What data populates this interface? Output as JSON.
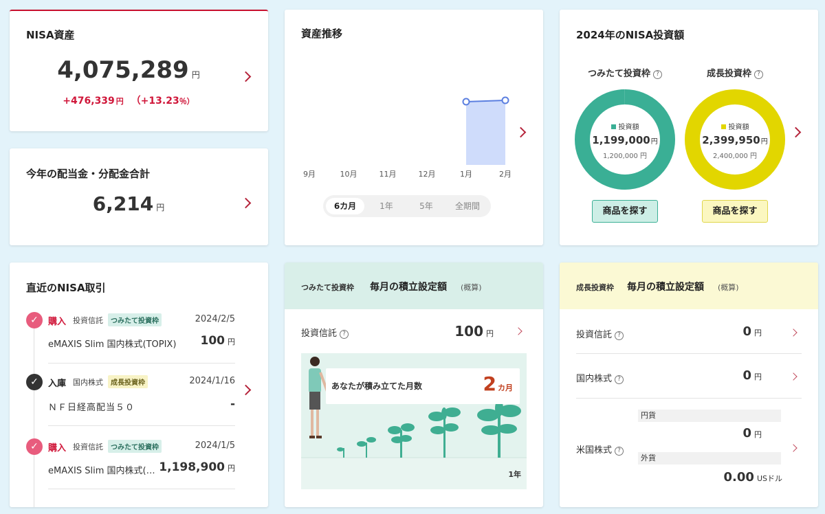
{
  "nisa_assets": {
    "title": "NISA資産",
    "amount": "4,075,289",
    "unit": "円",
    "gain": "+476,339",
    "gain_unit": "円",
    "gain_pct": "（+13.23",
    "pct_unit": "％）"
  },
  "dividends": {
    "title": "今年の配当金・分配金合計",
    "amount": "6,214",
    "unit": "円"
  },
  "asset_trend": {
    "title": "資産推移",
    "periods": [
      "6カ月",
      "1年",
      "5年",
      "全期間"
    ],
    "selected_period": "6カ月",
    "chart_data": {
      "type": "area",
      "x": [
        "9月",
        "10月",
        "11月",
        "12月",
        "1月",
        "2月"
      ],
      "series": [
        {
          "values": [
            null,
            null,
            null,
            null,
            3980000,
            4075289
          ]
        }
      ]
    }
  },
  "investment_2024": {
    "title": "2024年のNISA投資額",
    "tsumitate": {
      "label": "つみたて投資枠",
      "legend": "投資額",
      "amount": "1,199,000",
      "unit": "円",
      "limit": "1,200,000 円",
      "button": "商品を探す",
      "color": "#3aaf95",
      "fraction": 0.9992
    },
    "seicho": {
      "label": "成長投資枠",
      "legend": "投資額",
      "amount": "2,399,950",
      "unit": "円",
      "limit": "2,400,000 円",
      "button": "商品を探す",
      "color": "#e2d600",
      "fraction": 0.99998
    }
  },
  "recent": {
    "title": "直近のNISA取引",
    "items": [
      {
        "type": "購入",
        "category": "投資信託",
        "tag": "つみたて投資枠",
        "tag_kind": "tsumi",
        "date": "2024/2/5",
        "name": "eMAXIS Slim 国内株式(TOPIX)",
        "amount": "100",
        "unit": "円"
      },
      {
        "type": "入庫",
        "category": "国内株式",
        "tag": "成長投資枠",
        "tag_kind": "seicho",
        "date": "2024/1/16",
        "name": "ＮＦ日経高配当５０",
        "amount": "-",
        "unit": ""
      },
      {
        "type": "購入",
        "category": "投資信託",
        "tag": "つみたて投資枠",
        "tag_kind": "tsumi",
        "date": "2024/1/5",
        "name": "eMAXIS Slim 国内株式(…",
        "amount": "1,198,900",
        "unit": "円"
      }
    ]
  },
  "tsumitate_monthly": {
    "prefix": "つみたて投資枠",
    "title": "毎月の積立設定額",
    "note": "(概算)",
    "fund_label": "投資信託",
    "fund_amount": "100",
    "fund_unit": "円",
    "months_label": "あなたが積み立てた月数",
    "months_value": "2",
    "months_unit": "カ月",
    "axis_label": "1年"
  },
  "seicho_monthly": {
    "prefix": "成長投資枠",
    "title": "毎月の積立設定額",
    "note": "(概算)",
    "fund_label": "投資信託",
    "fund_amount": "0",
    "fund_unit": "円",
    "domestic_label": "国内株式",
    "domestic_amount": "0",
    "domestic_unit": "円",
    "us_label": "米国株式",
    "jpy_label": "円貨",
    "jpy_amount": "0",
    "jpy_unit": "円",
    "fx_label": "外貨",
    "fx_amount": "0.00",
    "fx_unit": "USドル"
  }
}
